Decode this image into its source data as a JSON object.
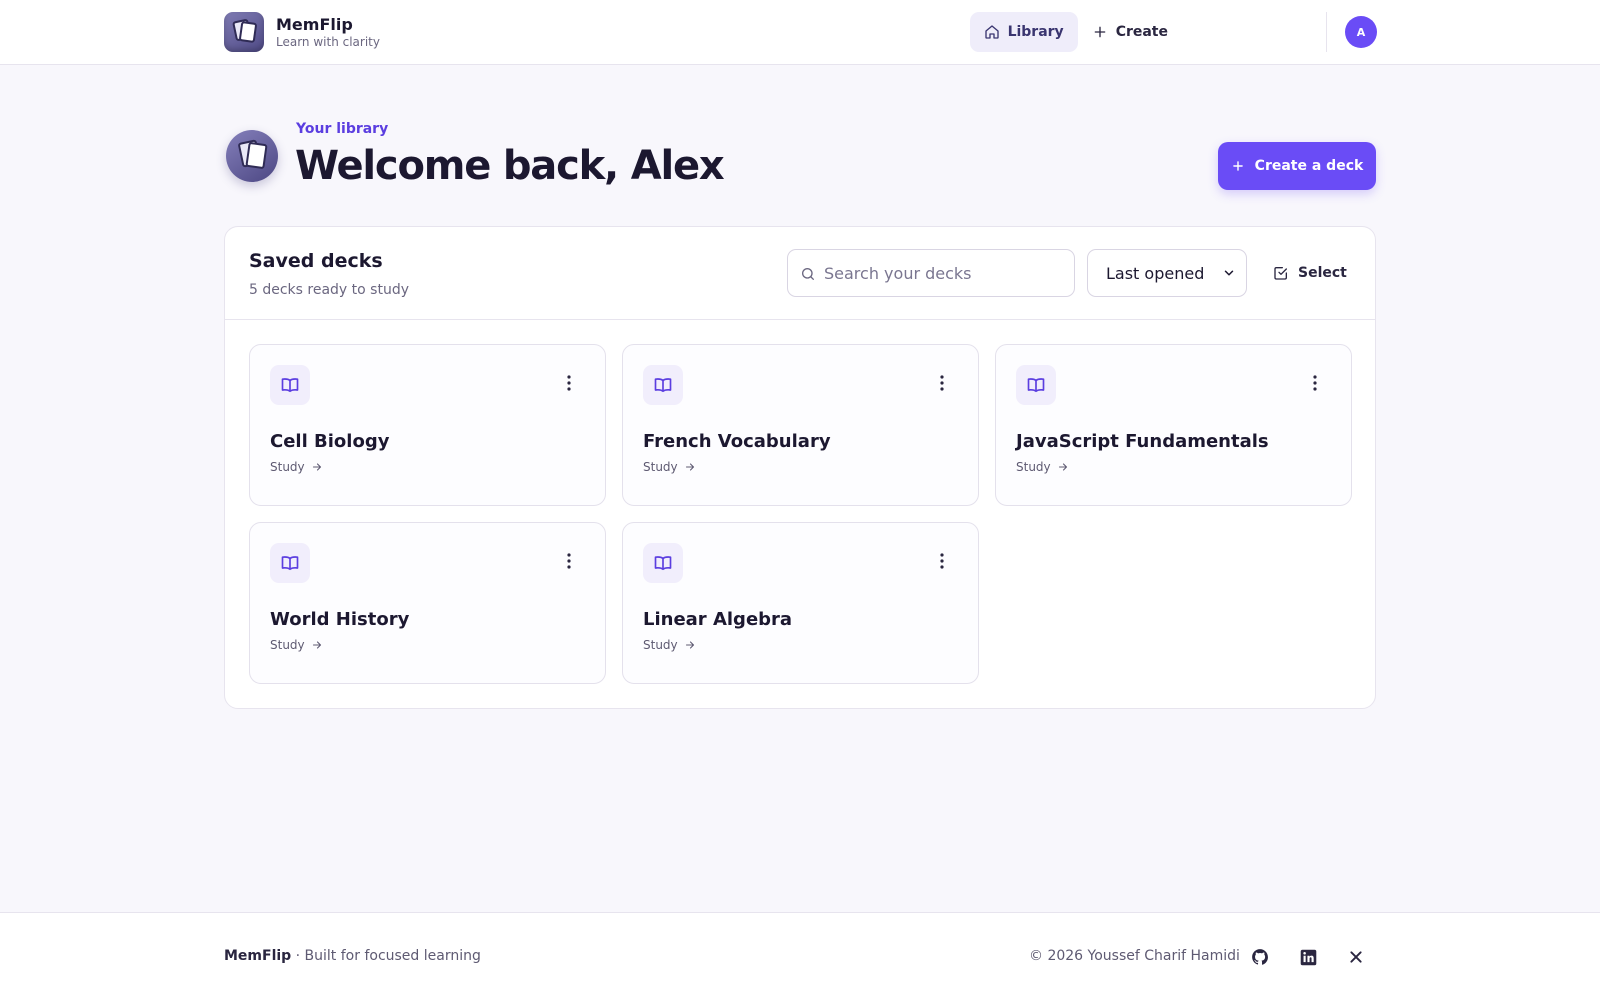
{
  "brand": {
    "name": "MemFlip",
    "tagline": "Learn with clarity"
  },
  "nav": {
    "library": "Library",
    "create": "Create",
    "avatar_initial": "A"
  },
  "hero": {
    "eyebrow": "Your library",
    "title": "Welcome back, Alex",
    "create_button": "Create a deck"
  },
  "panel": {
    "title": "Saved decks",
    "subtitle": "5 decks ready to study",
    "search_placeholder": "Search your decks",
    "sort_value": "Last opened",
    "select_label": "Select"
  },
  "decks": [
    {
      "title": "Cell Biology",
      "action": "Study"
    },
    {
      "title": "French Vocabulary",
      "action": "Study"
    },
    {
      "title": "JavaScript Fundamentals",
      "action": "Study"
    },
    {
      "title": "World History",
      "action": "Study"
    },
    {
      "title": "Linear Algebra",
      "action": "Study"
    }
  ],
  "footer": {
    "brand": "MemFlip",
    "tagline": " · Built for focused learning",
    "copyright": "© 2026 Youssef Charif Hamidi",
    "social": [
      "github-icon",
      "linkedin-icon",
      "x-icon"
    ]
  },
  "colors": {
    "accent": "#6a4cf6",
    "eyebrow": "#5b3ee0",
    "background": "#f8f7fc"
  }
}
